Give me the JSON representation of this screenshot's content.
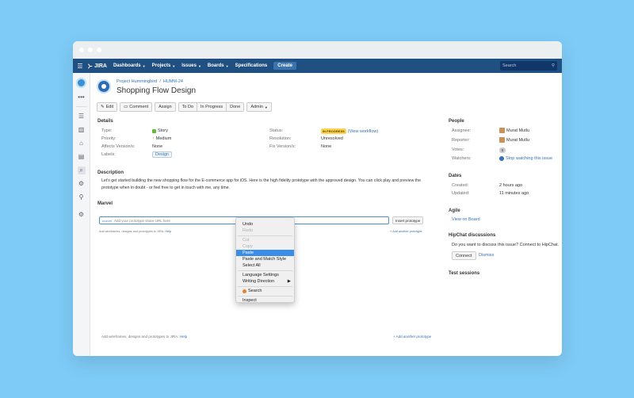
{
  "nav": {
    "logo": "JIRA",
    "items": [
      "Dashboards",
      "Projects",
      "Issues",
      "Boards",
      "Specifications"
    ],
    "create_label": "Create",
    "search_placeholder": "Search"
  },
  "issue": {
    "project": "Project Hummingbird",
    "key": "HUMM-24",
    "title": "Shopping Flow Design"
  },
  "toolbar": {
    "edit": "Edit",
    "comment": "Comment",
    "assign": "Assign",
    "todo": "To Do",
    "in_progress": "In Progress",
    "done": "Done",
    "admin": "Admin"
  },
  "details": {
    "heading": "Details",
    "type_label": "Type:",
    "type_value": "Story",
    "priority_label": "Priority:",
    "priority_value": "Medium",
    "affects_label": "Affects Version/s:",
    "affects_value": "None",
    "labels_label": "Labels:",
    "labels_value": "Design",
    "status_label": "Status:",
    "status_value": "IN PROGRESS",
    "status_link": "(View workflow)",
    "resolution_label": "Resolution:",
    "resolution_value": "Unresolved",
    "fix_label": "Fix Version/s:",
    "fix_value": "None"
  },
  "description": {
    "heading": "Description",
    "text": "Let's get started building the new shopping flow for the E-commerce app for iOS. Here is the high fidelity prototype with the approved design. You can click play and preview the prototype when in doubt - or feel free to get in touch with me, any time."
  },
  "marvel": {
    "heading": "Marvel",
    "logo": "marvel",
    "input_placeholder": "Add your prototype share URL here",
    "insert_label": "Insert prototype",
    "hint": "Add wireframes, designs and prototypes to JIRA.",
    "help": "Help",
    "add_another": "+ Add another prototype"
  },
  "footer_marvel": {
    "hint": "Add wireframes, designs and prototypes to JIRA.",
    "help": "Help",
    "add_another": "+ Add another prototype"
  },
  "context_menu": {
    "undo": "Undo",
    "redo": "Redo",
    "cut": "Cut",
    "copy": "Copy",
    "paste": "Paste",
    "paste_match": "Paste and Match Style",
    "select_all": "Select All",
    "language": "Language Settings",
    "writing": "Writing Direction",
    "search": "Search",
    "inspect": "Inspect"
  },
  "people": {
    "heading": "People",
    "assignee_label": "Assignee:",
    "assignee": "Murat Mutlu",
    "reporter_label": "Reporter:",
    "reporter": "Murat Mutlu",
    "votes_label": "Votes:",
    "votes": "0",
    "watchers_label": "Watchers:",
    "watch_link": "Stop watching this issue"
  },
  "dates": {
    "heading": "Dates",
    "created_label": "Created:",
    "created": "2 hours ago",
    "updated_label": "Updated:",
    "updated": "11 minutes ago"
  },
  "agile": {
    "heading": "Agile",
    "link": "View on Board"
  },
  "hipchat": {
    "heading": "HipChat discussions",
    "text": "Do you want to discuss this issue? Connect to HipChat.",
    "connect": "Connect",
    "dismiss": "Dismiss"
  },
  "test_sessions": {
    "heading": "Test sessions"
  },
  "colors": {
    "background": "#7ecbf7",
    "nav": "#205081",
    "link": "#3572b0",
    "lozenge": "#ffd351",
    "highlight": "#3b8de8"
  }
}
